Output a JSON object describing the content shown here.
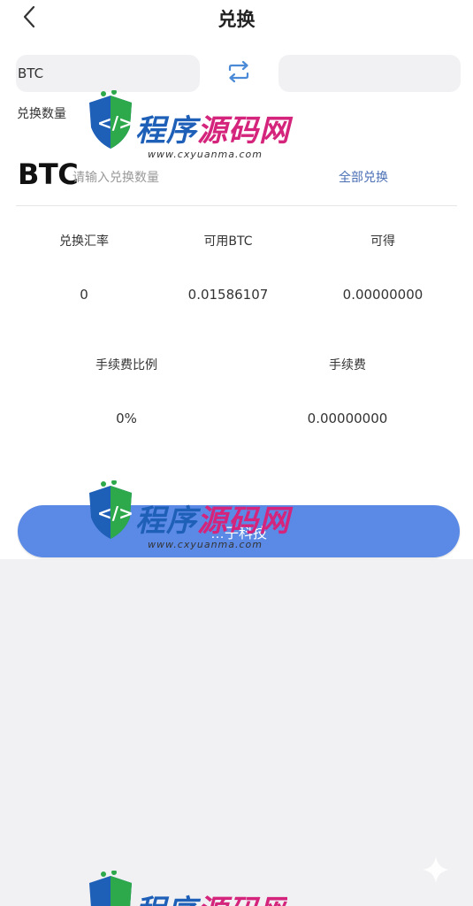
{
  "header": {
    "title": "兑换"
  },
  "exchange": {
    "from_coin": "BTC",
    "to_coin": "",
    "quantity_label": "兑换数量",
    "input_coin": "BTC",
    "input_placeholder": "请输入兑换数量",
    "input_value": "",
    "all_label": "全部兑换"
  },
  "stats": {
    "rate_label": "兑换汇率",
    "rate_value": "0",
    "available_label": "可用BTC",
    "available_value": "0.01586107",
    "receive_label": "可得",
    "receive_value": "0.00000000",
    "fee_ratio_label": "手续费比例",
    "fee_ratio_value": "0%",
    "fee_label": "手续费",
    "fee_value": "0.00000000"
  },
  "submit": {
    "label": "…子科技"
  },
  "watermark": {
    "text_blue": "程序",
    "text_pink": "源码网",
    "url": "www.cxyuanma.com"
  },
  "colors": {
    "accent": "#5b8ae6",
    "link": "#4a6fb5",
    "input_bg": "#f1f1f3"
  },
  "icons": {
    "back": "chevron-left-icon",
    "swap": "swap-arrows-icon"
  }
}
